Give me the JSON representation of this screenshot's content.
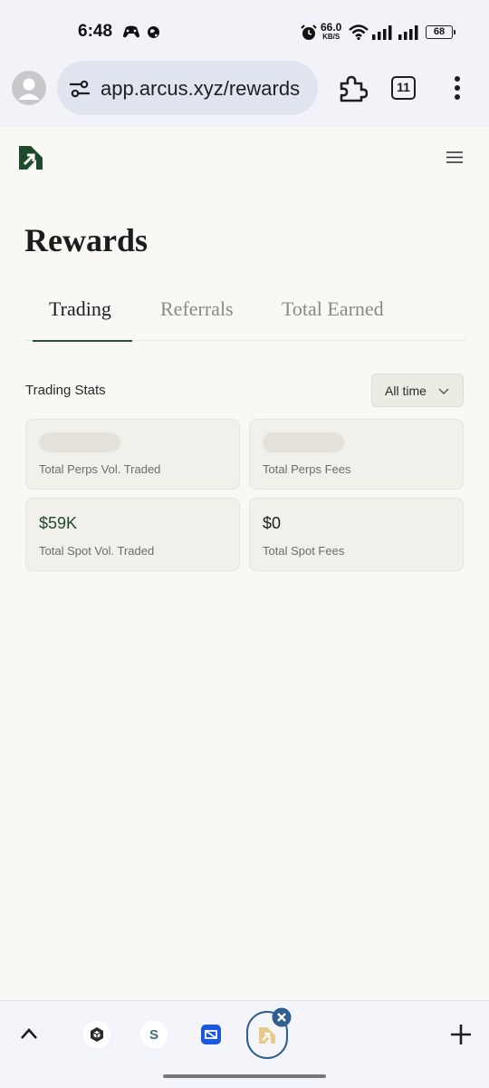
{
  "status_bar": {
    "time": "6:48",
    "net_speed_value": "66.0",
    "net_speed_unit": "KB/S",
    "battery": "68",
    "icons": [
      "game-controller-icon",
      "globe-icon",
      "alarm-icon",
      "wifi-icon",
      "signal-icon",
      "signal-icon"
    ]
  },
  "browser": {
    "url": "app.arcus.xyz/rewards",
    "tabs_count": "11",
    "icons": [
      "profile-icon",
      "site-settings-icon",
      "extensions-icon",
      "overflow-menu-icon"
    ]
  },
  "page": {
    "title": "Rewards",
    "tabs": [
      {
        "label": "Trading",
        "active": true
      },
      {
        "label": "Referrals",
        "active": false
      },
      {
        "label": "Total Earned",
        "active": false
      }
    ],
    "section_label": "Trading Stats",
    "filter_label": "All time",
    "cards": [
      {
        "label": "Total Perps Vol. Traded",
        "value": null
      },
      {
        "label": "Total Perps Fees",
        "value": null
      },
      {
        "label": "Total Spot Vol. Traded",
        "value": "$59K"
      },
      {
        "label": "Total Spot Fees",
        "value": "$0"
      }
    ],
    "accent_color": "#2c5236",
    "value_green": "#1f4a2c"
  },
  "bottom_bar": {
    "favicons": [
      "box-app-icon",
      "s-app-icon",
      "blue-app-icon",
      "arcus-app-icon"
    ],
    "s_glyph": "S"
  }
}
